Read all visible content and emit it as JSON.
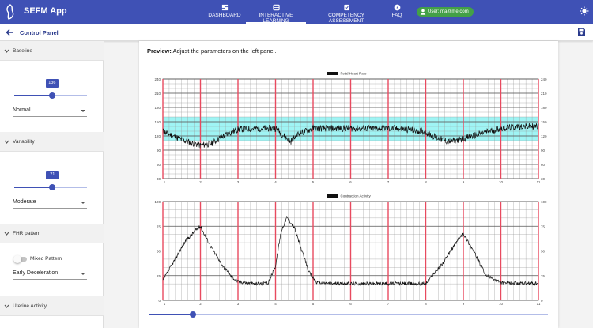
{
  "appbar": {
    "title": "SEFM App",
    "nav": [
      {
        "label": "DASHBOARD",
        "icon": "dashboard-icon"
      },
      {
        "label": "INTERACTIVE LEARNING",
        "icon": "learning-icon",
        "active": true
      },
      {
        "label": "COMPETENCY ASSESSMENT",
        "icon": "assessment-icon"
      },
      {
        "label": "FAQ",
        "icon": "help-icon"
      }
    ],
    "user_label": "User: ma@me.com",
    "accent": "#3f51b5",
    "user_chip_color": "#43a047"
  },
  "subbar": {
    "title": "Control Panel"
  },
  "sidebar": {
    "baseline": {
      "label": "Baseline",
      "slider_value": 136,
      "slider_min": 110,
      "slider_max": 160,
      "select_value": "Normal"
    },
    "variability": {
      "label": "Variability",
      "slider_value": 21,
      "slider_min": 0,
      "slider_max": 40,
      "select_value": "Moderate"
    },
    "fhr_pattern": {
      "label": "FHR pattern",
      "toggle_label": "Mixed Pattern",
      "toggle_on": false,
      "select_value": "Early Deceleration"
    },
    "uterine": {
      "label": "Uterine Activity"
    }
  },
  "preview": {
    "bold": "Preview:",
    "text": " Adjust the parameters on the left panel."
  },
  "timeline": {
    "position_fraction": 0.11
  },
  "chart_data": [
    {
      "type": "line",
      "title": "Fetal Heart Rate",
      "ylim": [
        30,
        240
      ],
      "yticks_left": [
        30,
        60,
        90,
        120,
        150,
        180,
        210,
        240
      ],
      "yticks_right": [
        30,
        60,
        90,
        120,
        150,
        180,
        210,
        240
      ],
      "xlim": [
        1,
        11
      ],
      "xticks": [
        "1",
        "2",
        "3",
        "4",
        "5",
        "6",
        "7",
        "8",
        "9",
        "10",
        "11"
      ],
      "normal_band": [
        110,
        160
      ],
      "band_color": "#7ff0f0",
      "series": [
        {
          "values_x": [
            1,
            1.5,
            2.0,
            2.3,
            2.6,
            3.0,
            3.5,
            4.0,
            4.2,
            4.4,
            4.6,
            5.0,
            5.5,
            6.0,
            6.5,
            7.0,
            7.5,
            8.0,
            8.3,
            8.6,
            9.0,
            9.5,
            10.0,
            10.5,
            11.0
          ],
          "values_y": [
            130,
            112,
            100,
            104,
            120,
            134,
            136,
            136,
            122,
            108,
            124,
            136,
            136,
            136,
            136,
            136,
            134,
            128,
            116,
            108,
            114,
            126,
            136,
            140,
            140
          ]
        }
      ]
    },
    {
      "type": "line",
      "title": "Contraction Activity",
      "ylim": [
        0,
        100
      ],
      "yticks_left": [
        0,
        25,
        50,
        75,
        100
      ],
      "yticks_right": [
        0,
        25,
        50,
        75,
        100
      ],
      "xlim": [
        1,
        11
      ],
      "xticks": [
        "1",
        "2",
        "3",
        "4",
        "5",
        "6",
        "7",
        "8",
        "9",
        "10",
        "11"
      ],
      "series": [
        {
          "values_x": [
            1,
            1.3,
            1.6,
            1.9,
            2.0,
            2.2,
            2.5,
            2.8,
            3.0,
            3.4,
            3.8,
            4.0,
            4.15,
            4.3,
            4.5,
            4.7,
            4.9,
            5.1,
            5.5,
            6.5,
            7.5,
            8.0,
            8.5,
            8.8,
            9.0,
            9.3,
            9.6,
            10.0,
            10.5,
            11.0
          ],
          "values_y": [
            20,
            40,
            60,
            72,
            75,
            60,
            40,
            25,
            19,
            17,
            17,
            35,
            70,
            84,
            74,
            50,
            28,
            18,
            17,
            17,
            17,
            17,
            40,
            58,
            68,
            48,
            25,
            18,
            17,
            17
          ]
        }
      ]
    }
  ]
}
